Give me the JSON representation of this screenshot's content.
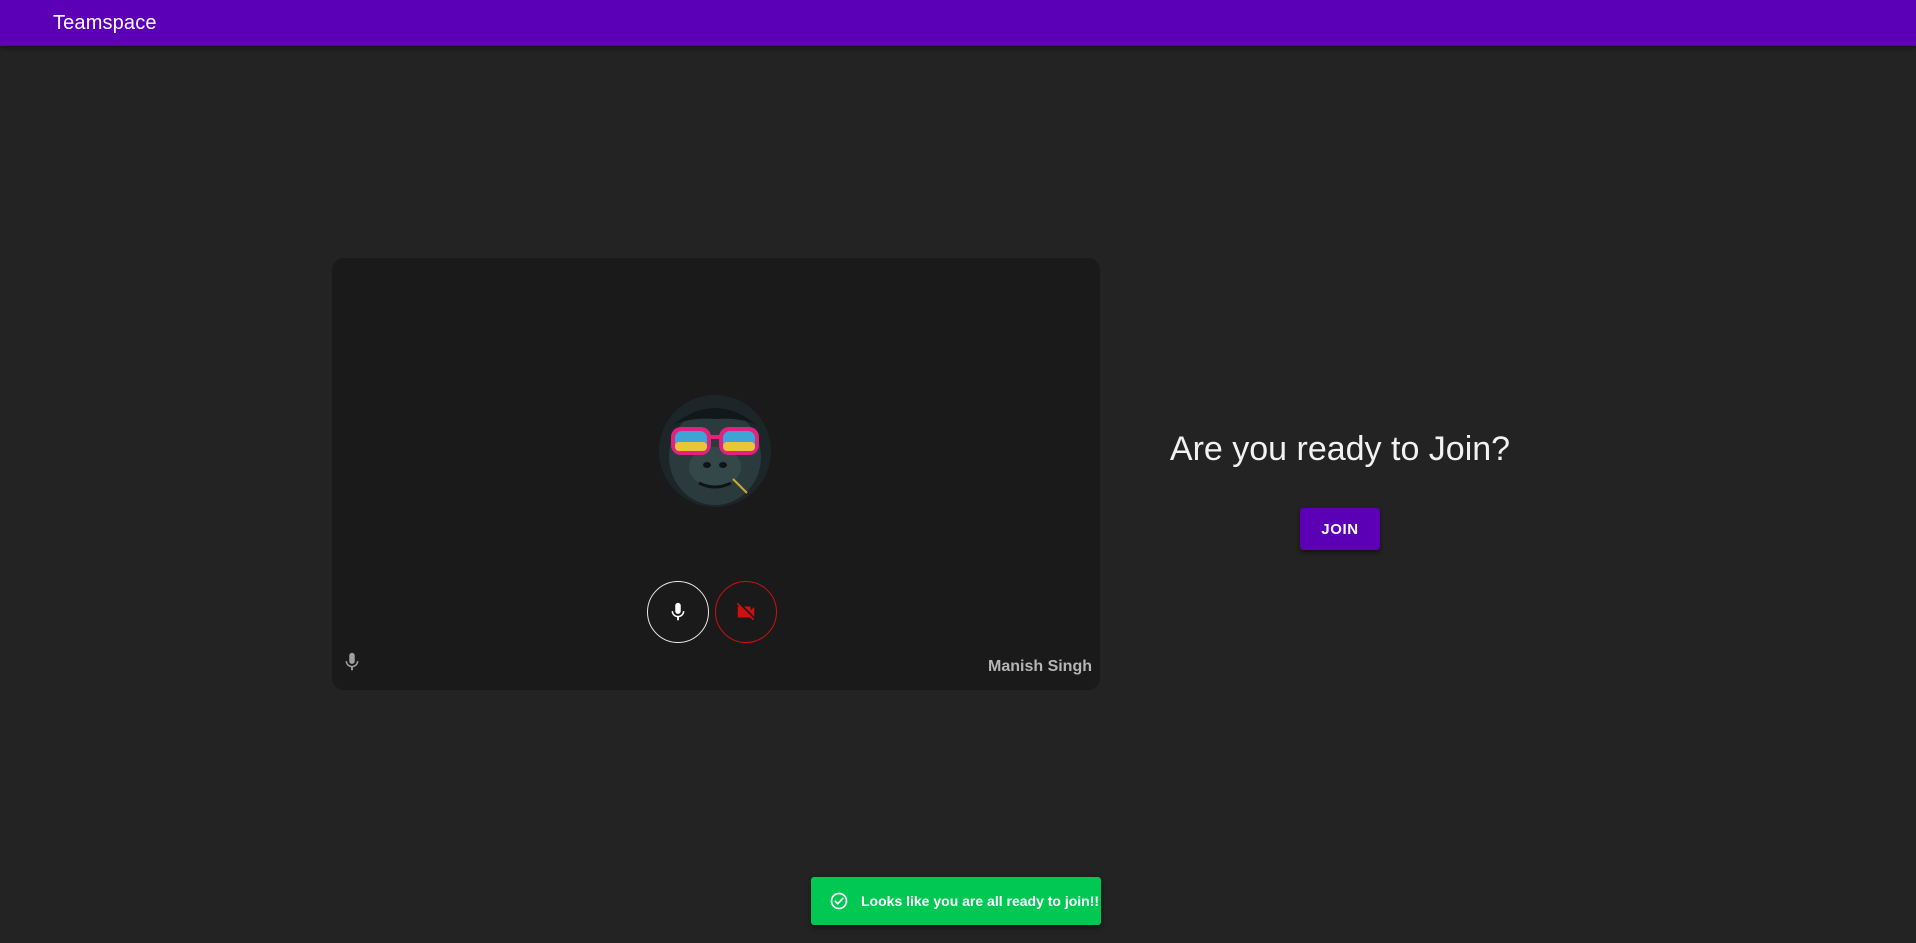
{
  "app": {
    "title": "Teamspace"
  },
  "preview": {
    "participant_name": "Manish Singh",
    "avatar_icon": "gorilla-avatar",
    "mic_state": "on",
    "camera_state": "off"
  },
  "join": {
    "prompt": "Are you ready to Join?",
    "button_label": "JOIN"
  },
  "toast": {
    "message": "Looks like you are all ready to join!!",
    "icon": "check-circle-icon"
  },
  "colors": {
    "brand": "#5c00b8",
    "background": "#232323",
    "card": "#1a1a1a",
    "success": "#00c853",
    "danger": "#d01010"
  }
}
